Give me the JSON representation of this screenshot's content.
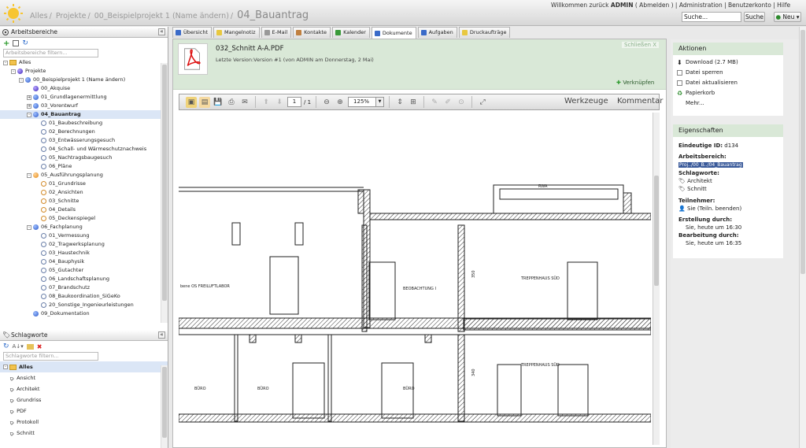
{
  "breadcrumb": {
    "items": [
      "Alles",
      "Projekte",
      "00_Beispielprojekt 1 (Name ändern)"
    ],
    "current": "04_Bauantrag"
  },
  "topbar": {
    "welcome_prefix": "Willkommen zurück",
    "user": "ADMIN",
    "logout": "( Abmelden )",
    "links": [
      "Administration",
      "Benutzerkonto",
      "Hilfe"
    ],
    "search_placeholder": "Suche...",
    "search_button": "Suche",
    "new_button": "Neu"
  },
  "left": {
    "workspace_title": "Arbeitsbereiche",
    "workspace_filter": "Arbeitsbereiche filtern...",
    "tree": [
      {
        "label": "Alles",
        "level": 0,
        "icon": "folder",
        "toggle": "-"
      },
      {
        "label": "Projekte",
        "level": 1,
        "icon": "purple",
        "toggle": "-"
      },
      {
        "label": "00_Beispielprojekt 1 (Name ändern)",
        "level": 2,
        "icon": "blue",
        "toggle": "-"
      },
      {
        "label": "00_Akquise",
        "level": 3,
        "icon": "purple",
        "toggle": ""
      },
      {
        "label": "01_Grundlagenermittlung",
        "level": 3,
        "icon": "blue",
        "toggle": "+"
      },
      {
        "label": "03_Vorentwurf",
        "level": 3,
        "icon": "blue",
        "toggle": "+"
      },
      {
        "label": "04_Bauantrag",
        "level": 3,
        "icon": "blue",
        "toggle": "-",
        "selected": true,
        "bold": true
      },
      {
        "label": "01_Baubeschreibung",
        "level": 4,
        "icon": "empty",
        "toggle": ""
      },
      {
        "label": "02_Berechnungen",
        "level": 4,
        "icon": "empty",
        "toggle": ""
      },
      {
        "label": "03_Entwässerungsgesuch",
        "level": 4,
        "icon": "empty",
        "toggle": ""
      },
      {
        "label": "04_Schall- und Wärmeschutznachweis",
        "level": 4,
        "icon": "empty",
        "toggle": ""
      },
      {
        "label": "05_Nachtragsbaugesuch",
        "level": 4,
        "icon": "empty",
        "toggle": ""
      },
      {
        "label": "06_Pläne",
        "level": 4,
        "icon": "empty",
        "toggle": ""
      },
      {
        "label": "05_Ausführungsplanung",
        "level": 3,
        "icon": "orange",
        "toggle": "-"
      },
      {
        "label": "01_Grundrisse",
        "level": 4,
        "icon": "oempty",
        "toggle": ""
      },
      {
        "label": "02_Ansichten",
        "level": 4,
        "icon": "oempty",
        "toggle": ""
      },
      {
        "label": "03_Schnitte",
        "level": 4,
        "icon": "oempty",
        "toggle": ""
      },
      {
        "label": "04_Details",
        "level": 4,
        "icon": "oempty",
        "toggle": ""
      },
      {
        "label": "05_Deckenspiegel",
        "level": 4,
        "icon": "oempty",
        "toggle": ""
      },
      {
        "label": "06_Fachplanung",
        "level": 3,
        "icon": "blue",
        "toggle": "-"
      },
      {
        "label": "01_Vermessung",
        "level": 4,
        "icon": "empty",
        "toggle": ""
      },
      {
        "label": "02_Tragwerksplanung",
        "level": 4,
        "icon": "empty",
        "toggle": ""
      },
      {
        "label": "03_Haustechnik",
        "level": 4,
        "icon": "empty",
        "toggle": ""
      },
      {
        "label": "04_Bauphysik",
        "level": 4,
        "icon": "empty",
        "toggle": ""
      },
      {
        "label": "05_Gutachter",
        "level": 4,
        "icon": "empty",
        "toggle": ""
      },
      {
        "label": "06_Landschaftsplanung",
        "level": 4,
        "icon": "empty",
        "toggle": ""
      },
      {
        "label": "07_Brandschutz",
        "level": 4,
        "icon": "empty",
        "toggle": ""
      },
      {
        "label": "08_Baukoordination_SiGeKo",
        "level": 4,
        "icon": "empty",
        "toggle": ""
      },
      {
        "label": "20_Sonstige_Ingenieurleistungen",
        "level": 4,
        "icon": "empty",
        "toggle": ""
      },
      {
        "label": "09_Dokumentation",
        "level": 3,
        "icon": "blue",
        "toggle": ""
      }
    ],
    "tags_title": "Schlagworte",
    "tags_filter": "Schlagworte filtern...",
    "tags": [
      "Alles",
      "Ansicht",
      "Architekt",
      "Grundriss",
      "PDF",
      "Protokoll",
      "Schnitt"
    ]
  },
  "tabs": [
    "Übersicht",
    "Mangelnotiz",
    "E-Mail",
    "Kontakte",
    "Kalender",
    "Dokumente",
    "Aufgaben",
    "Druckaufträge"
  ],
  "active_tab": "Dokumente",
  "document": {
    "title": "032_Schnitt A-A.PDF",
    "version": "Letzte Version:Version #1 (von ADMIN am Donnerstag, 2 Mai)",
    "close": "Schließen  X",
    "link": "Verknüpfen",
    "page_current": "1",
    "page_total": "/ 1",
    "zoom": "125%",
    "tools": "Werkzeuge",
    "comment": "Kommentar"
  },
  "drawing_labels": {
    "rwa": "RWA",
    "room1": "BEOBACHTUNG I",
    "stair1": "TREPPENHAUS SÜD",
    "stair2": "TREPPENHAUS SÜD",
    "left": "bene OS FREILUFTLABOR",
    "b1": "BÜRO",
    "b2": "BÜRO",
    "b3": "BÜRO",
    "d350": "350",
    "d340": "340"
  },
  "right": {
    "actions_title": "Aktionen",
    "actions": [
      "Download (2.7 MB)",
      "Datei sperren",
      "Datei aktualisieren",
      "Papierkorb",
      "Mehr..."
    ],
    "props_title": "Eigenschaften",
    "id_label": "Eindeutige ID:",
    "id_value": "d134",
    "area_label": "Arbeitsbereich:",
    "area_value": "Proj../00_B../04_Bauantrag",
    "tags_label": "Schlagworte:",
    "tag_values": [
      "Architekt",
      "Schnitt"
    ],
    "participants_label": "Teilnehmer:",
    "participant": "Sie (Teiln. beenden)",
    "created_label": "Erstellung durch:",
    "created_value": "Sie, heute um 16:30",
    "edited_label": "Bearbeitung durch:",
    "edited_value": "Sie, heute um 16:35"
  }
}
